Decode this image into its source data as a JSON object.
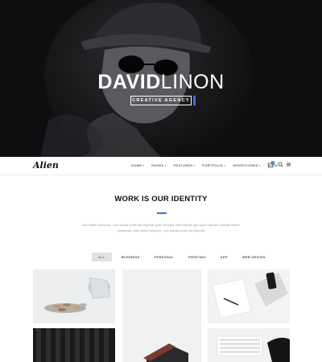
{
  "hero": {
    "title_bold": "DAVID",
    "title_light": "LINON",
    "subtitle": "CREATIVE AGENCY"
  },
  "nav": {
    "logo": "Alien",
    "items": [
      {
        "label": "HOME"
      },
      {
        "label": "PAGES"
      },
      {
        "label": "FEATURES"
      },
      {
        "label": "PORTFOLIO"
      },
      {
        "label": "SHORTCODES"
      },
      {
        "label": "BLOG"
      }
    ],
    "cart_count": "0",
    "icons": [
      "cart-icon",
      "search-icon",
      "menu-icon"
    ]
  },
  "work": {
    "title": "WORK IS OUR IDENTITY",
    "description": "Nam libero tempore, cum soluta nobis est eligendi optio cumque nihil impedit quo quod maxime placeat facere possimus. Nam libero tempore, cum soluta nobis est eligendi",
    "filters": [
      {
        "label": "ALL",
        "active": true
      },
      {
        "label": "BUSINESS",
        "active": false
      },
      {
        "label": "PERSONAL",
        "active": false
      },
      {
        "label": "PRINTING",
        "active": false
      },
      {
        "label": "APP",
        "active": false
      },
      {
        "label": "WEB DESIGN",
        "active": false
      }
    ]
  },
  "colors": {
    "accent": "#3f6fe0",
    "hero_bg": "#0e0e10",
    "text_dark": "#111111",
    "text_muted": "#9a9a9a"
  }
}
